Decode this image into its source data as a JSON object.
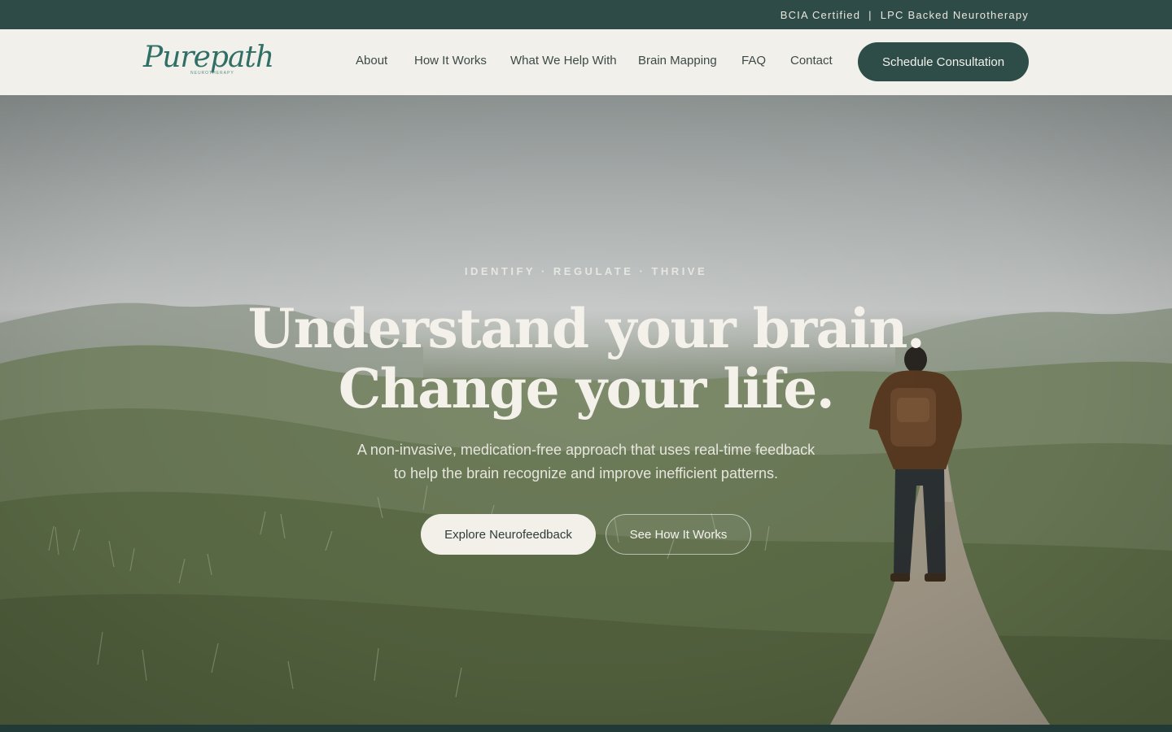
{
  "topbar": {
    "left_text": "BCIA Certified",
    "separator": "|",
    "right_text": "LPC Backed Neurotherapy"
  },
  "brand": {
    "logo_script": "Purepath",
    "logo_sub": "NEUROTHERAPY"
  },
  "nav": {
    "items": [
      {
        "label": "About"
      },
      {
        "label": "How It Works"
      },
      {
        "label": "What We Help With"
      },
      {
        "label": "Brain Mapping"
      },
      {
        "label": "FAQ"
      },
      {
        "label": "Contact"
      }
    ],
    "cta_label": "Schedule Consultation"
  },
  "hero": {
    "eyebrow": "IDENTIFY · REGULATE · THRIVE",
    "headline_line1": "Understand your brain.",
    "headline_line2": "Change your life.",
    "subtext_line1": "A non-invasive, medication-free approach that uses real-time feedback",
    "subtext_line2": "to help the brain recognize and improve inefficient patterns.",
    "primary_button": "Explore Neurofeedback",
    "secondary_button": "See How It Works"
  },
  "colors": {
    "primary_dark_green": "#2f4b48",
    "cream": "#f2f0ea",
    "logo_teal": "#2f6f66"
  }
}
